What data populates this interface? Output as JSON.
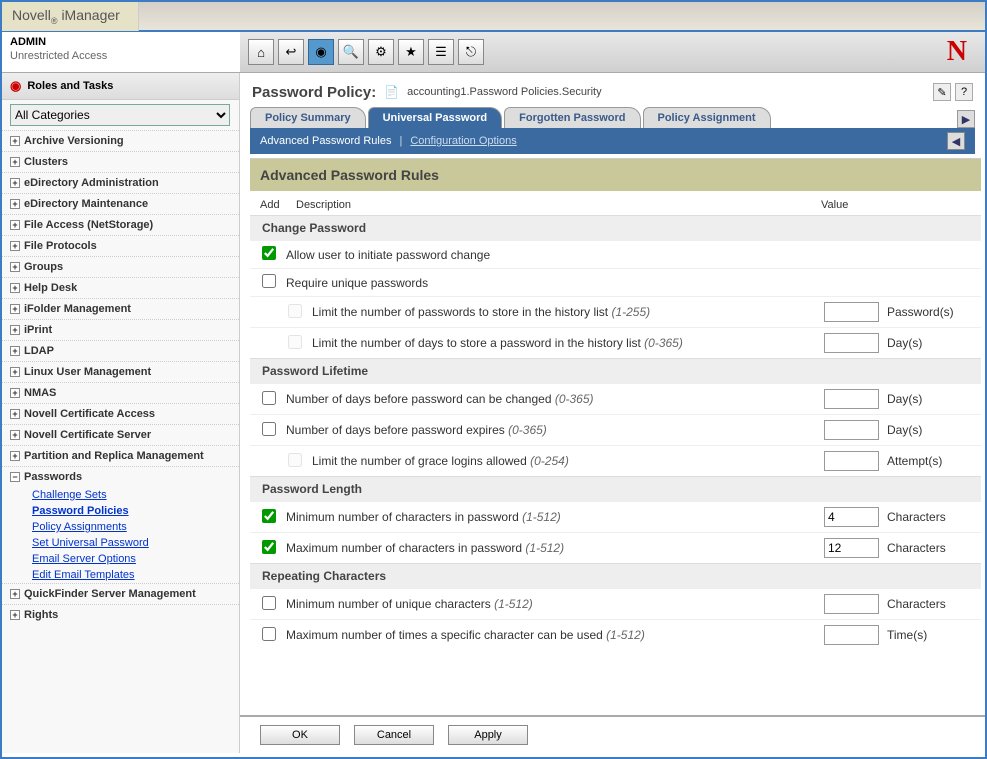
{
  "app": {
    "title_prefix": "Novell",
    "title_suffix": "iManager",
    "user": "ADMIN",
    "access": "Unrestricted Access",
    "n_logo": "N"
  },
  "toolbar": {
    "icons": [
      {
        "name": "home-icon",
        "glyph": "⌂"
      },
      {
        "name": "back-icon",
        "glyph": "↩"
      },
      {
        "name": "roles-icon",
        "glyph": "◉",
        "selected": true
      },
      {
        "name": "view-icon",
        "glyph": "🔍"
      },
      {
        "name": "config-icon",
        "glyph": "⚙"
      },
      {
        "name": "favorites-icon",
        "glyph": "★"
      },
      {
        "name": "list-icon",
        "glyph": "☰"
      },
      {
        "name": "exit-icon",
        "glyph": "⎋"
      }
    ]
  },
  "sidebar": {
    "heading": "Roles and Tasks",
    "category_selected": "All Categories",
    "items": [
      {
        "label": "Archive Versioning",
        "exp": "+"
      },
      {
        "label": "Clusters",
        "exp": "+"
      },
      {
        "label": "eDirectory Administration",
        "exp": "+"
      },
      {
        "label": "eDirectory Maintenance",
        "exp": "+"
      },
      {
        "label": "File Access (NetStorage)",
        "exp": "+"
      },
      {
        "label": "File Protocols",
        "exp": "+"
      },
      {
        "label": "Groups",
        "exp": "+"
      },
      {
        "label": "Help Desk",
        "exp": "+"
      },
      {
        "label": "iFolder Management",
        "exp": "+"
      },
      {
        "label": "iPrint",
        "exp": "+"
      },
      {
        "label": "LDAP",
        "exp": "+"
      },
      {
        "label": "Linux User Management",
        "exp": "+"
      },
      {
        "label": "NMAS",
        "exp": "+"
      },
      {
        "label": "Novell Certificate Access",
        "exp": "+"
      },
      {
        "label": "Novell Certificate Server",
        "exp": "+"
      },
      {
        "label": "Partition and Replica Management",
        "exp": "+"
      },
      {
        "label": "Passwords",
        "exp": "−",
        "children": [
          {
            "label": "Challenge Sets"
          },
          {
            "label": "Password Policies",
            "current": true
          },
          {
            "label": "Policy Assignments"
          },
          {
            "label": "Set Universal Password"
          },
          {
            "label": "Email Server Options"
          },
          {
            "label": "Edit Email Templates"
          }
        ]
      },
      {
        "label": "QuickFinder Server Management",
        "exp": "+"
      },
      {
        "label": "Rights",
        "exp": "+"
      }
    ]
  },
  "page": {
    "title": "Password Policy:",
    "object_path": "accounting1.Password Policies.Security",
    "tabs": [
      "Policy Summary",
      "Universal Password",
      "Forgotten Password",
      "Policy Assignment"
    ],
    "active_tab": 1,
    "subtabs": {
      "active": "Advanced Password Rules",
      "link": "Configuration Options"
    }
  },
  "rules": {
    "title": "Advanced Password Rules",
    "cols": {
      "add": "Add",
      "desc": "Description",
      "value": "Value"
    },
    "groups": [
      {
        "name": "Change Password",
        "rows": [
          {
            "checked": true,
            "desc": "Allow user to initiate password change"
          },
          {
            "checked": false,
            "desc": "Require unique passwords"
          },
          {
            "indent": true,
            "disabled": true,
            "desc": "Limit the number of passwords to store in the history list",
            "hint": "(1-255)",
            "value": "",
            "unit": "Password(s)"
          },
          {
            "indent": true,
            "disabled": true,
            "desc": "Limit the number of days to store a password in the history list",
            "hint": "(0-365)",
            "value": "",
            "unit": "Day(s)"
          }
        ]
      },
      {
        "name": "Password Lifetime",
        "rows": [
          {
            "checked": false,
            "desc": "Number of days before password can be changed",
            "hint": "(0-365)",
            "value": "",
            "unit": "Day(s)"
          },
          {
            "checked": false,
            "desc": "Number of days before password expires",
            "hint": "(0-365)",
            "value": "",
            "unit": "Day(s)"
          },
          {
            "indent": true,
            "disabled": true,
            "desc": "Limit the number of grace logins allowed",
            "hint": "(0-254)",
            "value": "",
            "unit": "Attempt(s)"
          }
        ]
      },
      {
        "name": "Password Length",
        "rows": [
          {
            "checked": true,
            "desc": "Minimum number of characters in password",
            "hint": "(1-512)",
            "value": "4",
            "unit": "Characters"
          },
          {
            "checked": true,
            "desc": "Maximum number of characters in password",
            "hint": "(1-512)",
            "value": "12",
            "unit": "Characters"
          }
        ]
      },
      {
        "name": "Repeating Characters",
        "rows": [
          {
            "checked": false,
            "desc": "Minimum number of unique characters",
            "hint": "(1-512)",
            "value": "",
            "unit": "Characters"
          },
          {
            "checked": false,
            "desc": "Maximum number of times a specific character can be used",
            "hint": "(1-512)",
            "value": "",
            "unit": "Time(s)"
          }
        ]
      }
    ]
  },
  "buttons": {
    "ok": "OK",
    "cancel": "Cancel",
    "apply": "Apply"
  }
}
